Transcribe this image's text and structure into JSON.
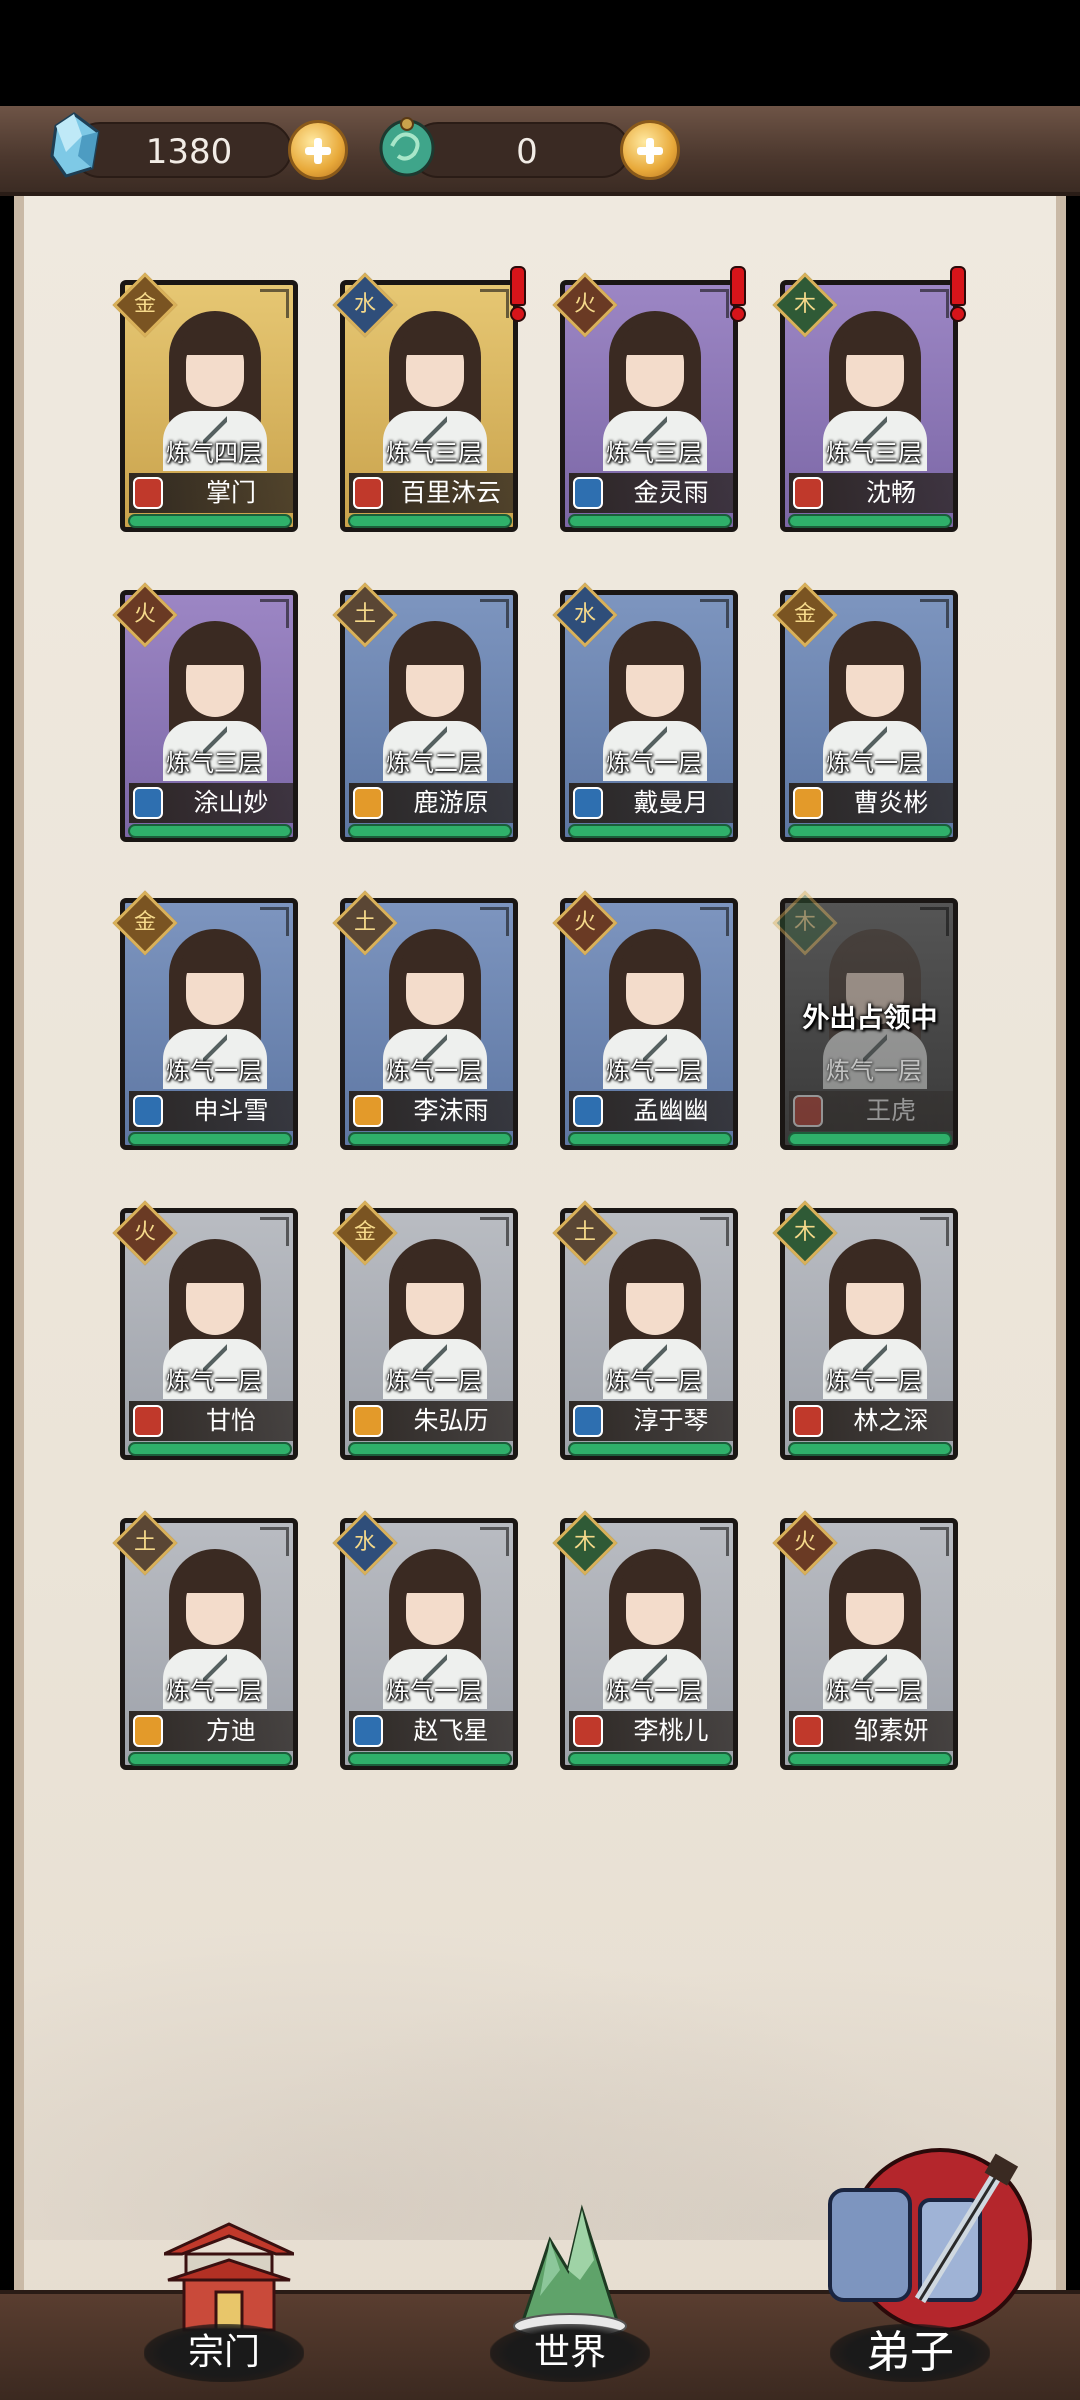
{
  "currency": {
    "spirit_stone": {
      "icon": "spirit-stone-icon",
      "value": "1380"
    },
    "jade": {
      "icon": "jade-icon",
      "value": "0"
    }
  },
  "disciples": [
    {
      "element": "金",
      "realm": "炼气四层",
      "name": "掌门",
      "rarity": "gold",
      "role": "red",
      "alert": false
    },
    {
      "element": "水",
      "realm": "炼气三层",
      "name": "百里沐云",
      "rarity": "gold",
      "role": "red",
      "alert": true
    },
    {
      "element": "火",
      "realm": "炼气三层",
      "name": "金灵雨",
      "rarity": "purple",
      "role": "blue",
      "alert": true
    },
    {
      "element": "木",
      "realm": "炼气三层",
      "name": "沈畅",
      "rarity": "purple",
      "role": "red",
      "alert": true
    },
    {
      "element": "火",
      "realm": "炼气三层",
      "name": "涂山妙",
      "rarity": "purple",
      "role": "blue",
      "alert": false
    },
    {
      "element": "土",
      "realm": "炼气二层",
      "name": "鹿游原",
      "rarity": "blue",
      "role": "orange",
      "alert": false
    },
    {
      "element": "水",
      "realm": "炼气一层",
      "name": "戴曼月",
      "rarity": "blue",
      "role": "blue",
      "alert": false
    },
    {
      "element": "金",
      "realm": "炼气一层",
      "name": "曹炎彬",
      "rarity": "blue",
      "role": "orange",
      "alert": false
    },
    {
      "element": "金",
      "realm": "炼气一层",
      "name": "申斗雪",
      "rarity": "blue",
      "role": "blue",
      "alert": false
    },
    {
      "element": "土",
      "realm": "炼气一层",
      "name": "李沫雨",
      "rarity": "blue",
      "role": "orange",
      "alert": false
    },
    {
      "element": "火",
      "realm": "炼气一层",
      "name": "孟幽幽",
      "rarity": "blue",
      "role": "blue",
      "alert": false
    },
    {
      "element": "木",
      "realm": "炼气一层",
      "name": "王虎",
      "rarity": "away",
      "role": "red",
      "alert": false,
      "status": "外出占领中"
    },
    {
      "element": "火",
      "realm": "炼气一层",
      "name": "甘怡",
      "rarity": "gray",
      "role": "red",
      "alert": false
    },
    {
      "element": "金",
      "realm": "炼气一层",
      "name": "朱弘历",
      "rarity": "gray",
      "role": "orange",
      "alert": false
    },
    {
      "element": "土",
      "realm": "炼气一层",
      "name": "淳于琴",
      "rarity": "gray",
      "role": "blue",
      "alert": false
    },
    {
      "element": "木",
      "realm": "炼气一层",
      "name": "林之深",
      "rarity": "gray",
      "role": "red",
      "alert": false
    },
    {
      "element": "土",
      "realm": "炼气一层",
      "name": "方迪",
      "rarity": "gray",
      "role": "orange",
      "alert": false
    },
    {
      "element": "水",
      "realm": "炼气一层",
      "name": "赵飞星",
      "rarity": "gray",
      "role": "blue",
      "alert": false
    },
    {
      "element": "木",
      "realm": "炼气一层",
      "name": "李桃儿",
      "rarity": "gray",
      "role": "red",
      "alert": false
    },
    {
      "element": "火",
      "realm": "炼气一层",
      "name": "邹素妍",
      "rarity": "gray",
      "role": "red",
      "alert": false
    }
  ],
  "nav": [
    {
      "label": "宗门",
      "icon": "temple-icon",
      "active": false
    },
    {
      "label": "世界",
      "icon": "mountain-icon",
      "active": false
    },
    {
      "label": "弟子",
      "icon": "scroll-icon",
      "active": true
    }
  ],
  "colors": {
    "hp_bar": "#2fb06a",
    "alert": "#d7141a",
    "panel": "#eae3d9"
  }
}
